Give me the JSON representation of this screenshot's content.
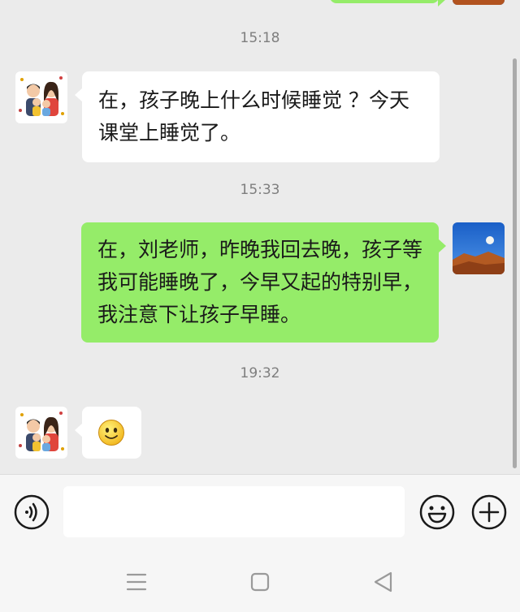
{
  "chat": {
    "timestamps": [
      "15:18",
      "15:33",
      "19:32"
    ],
    "messages": [
      {
        "side": "in",
        "text": "在，孩子晚上什么时候睡觉 ？今天课堂上睡觉了。"
      },
      {
        "side": "out",
        "text": "在，刘老师，昨晚我回去晚，孩子等我可能睡晚了，今早又起的特别早，我注意下让孩子早睡。"
      },
      {
        "side": "in",
        "emoji": "🙂"
      }
    ]
  },
  "input": {
    "value": ""
  },
  "icons": {
    "voice": "voice-icon",
    "emoji": "emoji-face-icon",
    "plus": "plus-icon",
    "nav_menu": "menu-icon",
    "nav_home": "home-square-icon",
    "nav_back": "back-triangle-icon"
  },
  "colors": {
    "background": "#ebebeb",
    "outgoing_bubble": "#95ec69",
    "incoming_bubble": "#ffffff",
    "timestamp": "#7e7e7e"
  }
}
